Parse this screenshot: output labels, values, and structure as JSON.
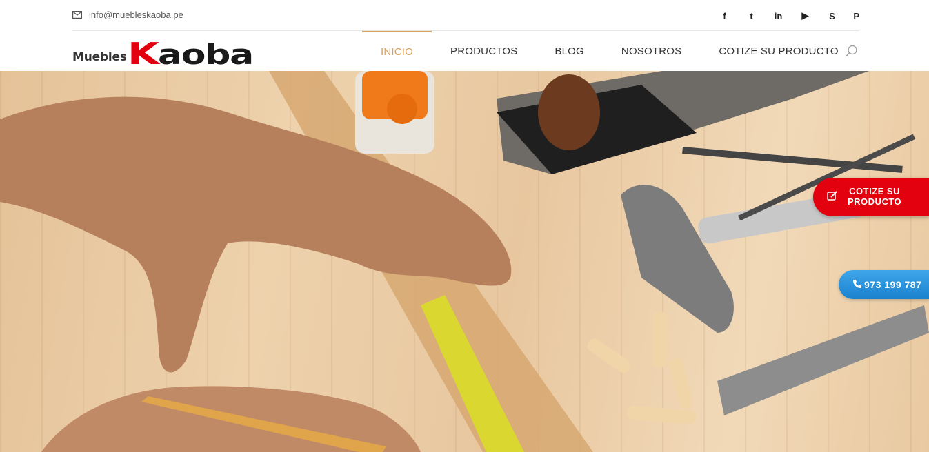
{
  "topbar": {
    "email": "info@muebleskaoba.pe",
    "social": [
      {
        "name": "facebook-icon",
        "glyph": "f"
      },
      {
        "name": "twitter-icon",
        "glyph": "t"
      },
      {
        "name": "linkedin-icon",
        "glyph": "in"
      },
      {
        "name": "youtube-icon",
        "glyph": "▶"
      },
      {
        "name": "skype-icon",
        "glyph": "S"
      },
      {
        "name": "pinterest-icon",
        "glyph": "P"
      }
    ]
  },
  "logo": {
    "prefix": "Muebles",
    "k": "K",
    "rest": "aoba"
  },
  "nav": {
    "items": [
      {
        "label": "INICIO",
        "active": true
      },
      {
        "label": "PRODUCTOS",
        "active": false
      },
      {
        "label": "BLOG",
        "active": false
      },
      {
        "label": "NOSOTROS",
        "active": false
      },
      {
        "label": "COTIZE SU PRODUCTO",
        "active": false
      }
    ]
  },
  "floating": {
    "quote_line1": "COTIZE SU",
    "quote_line2": "PRODUCTO",
    "phone": "973 199 787"
  },
  "colors": {
    "accent": "#d9a05b",
    "brand_red": "#e3000f",
    "phone_blue": "#1a82cf"
  }
}
